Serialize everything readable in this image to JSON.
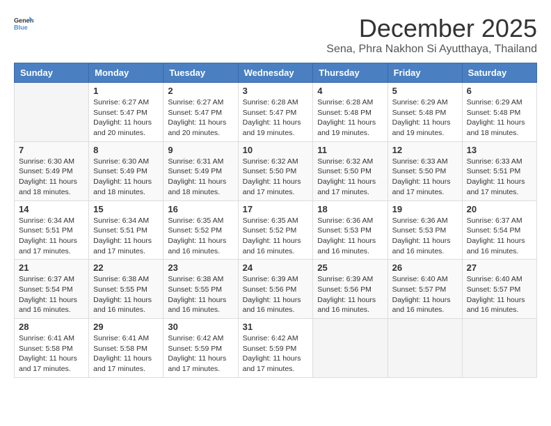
{
  "header": {
    "logo_general": "General",
    "logo_blue": "Blue",
    "month_title": "December 2025",
    "subtitle": "Sena, Phra Nakhon Si Ayutthaya, Thailand"
  },
  "days_of_week": [
    "Sunday",
    "Monday",
    "Tuesday",
    "Wednesday",
    "Thursday",
    "Friday",
    "Saturday"
  ],
  "weeks": [
    [
      {
        "day": "",
        "info": ""
      },
      {
        "day": "1",
        "info": "Sunrise: 6:27 AM\nSunset: 5:47 PM\nDaylight: 11 hours\nand 20 minutes."
      },
      {
        "day": "2",
        "info": "Sunrise: 6:27 AM\nSunset: 5:47 PM\nDaylight: 11 hours\nand 20 minutes."
      },
      {
        "day": "3",
        "info": "Sunrise: 6:28 AM\nSunset: 5:47 PM\nDaylight: 11 hours\nand 19 minutes."
      },
      {
        "day": "4",
        "info": "Sunrise: 6:28 AM\nSunset: 5:48 PM\nDaylight: 11 hours\nand 19 minutes."
      },
      {
        "day": "5",
        "info": "Sunrise: 6:29 AM\nSunset: 5:48 PM\nDaylight: 11 hours\nand 19 minutes."
      },
      {
        "day": "6",
        "info": "Sunrise: 6:29 AM\nSunset: 5:48 PM\nDaylight: 11 hours\nand 18 minutes."
      }
    ],
    [
      {
        "day": "7",
        "info": "Sunrise: 6:30 AM\nSunset: 5:49 PM\nDaylight: 11 hours\nand 18 minutes."
      },
      {
        "day": "8",
        "info": "Sunrise: 6:30 AM\nSunset: 5:49 PM\nDaylight: 11 hours\nand 18 minutes."
      },
      {
        "day": "9",
        "info": "Sunrise: 6:31 AM\nSunset: 5:49 PM\nDaylight: 11 hours\nand 18 minutes."
      },
      {
        "day": "10",
        "info": "Sunrise: 6:32 AM\nSunset: 5:50 PM\nDaylight: 11 hours\nand 17 minutes."
      },
      {
        "day": "11",
        "info": "Sunrise: 6:32 AM\nSunset: 5:50 PM\nDaylight: 11 hours\nand 17 minutes."
      },
      {
        "day": "12",
        "info": "Sunrise: 6:33 AM\nSunset: 5:50 PM\nDaylight: 11 hours\nand 17 minutes."
      },
      {
        "day": "13",
        "info": "Sunrise: 6:33 AM\nSunset: 5:51 PM\nDaylight: 11 hours\nand 17 minutes."
      }
    ],
    [
      {
        "day": "14",
        "info": "Sunrise: 6:34 AM\nSunset: 5:51 PM\nDaylight: 11 hours\nand 17 minutes."
      },
      {
        "day": "15",
        "info": "Sunrise: 6:34 AM\nSunset: 5:51 PM\nDaylight: 11 hours\nand 17 minutes."
      },
      {
        "day": "16",
        "info": "Sunrise: 6:35 AM\nSunset: 5:52 PM\nDaylight: 11 hours\nand 16 minutes."
      },
      {
        "day": "17",
        "info": "Sunrise: 6:35 AM\nSunset: 5:52 PM\nDaylight: 11 hours\nand 16 minutes."
      },
      {
        "day": "18",
        "info": "Sunrise: 6:36 AM\nSunset: 5:53 PM\nDaylight: 11 hours\nand 16 minutes."
      },
      {
        "day": "19",
        "info": "Sunrise: 6:36 AM\nSunset: 5:53 PM\nDaylight: 11 hours\nand 16 minutes."
      },
      {
        "day": "20",
        "info": "Sunrise: 6:37 AM\nSunset: 5:54 PM\nDaylight: 11 hours\nand 16 minutes."
      }
    ],
    [
      {
        "day": "21",
        "info": "Sunrise: 6:37 AM\nSunset: 5:54 PM\nDaylight: 11 hours\nand 16 minutes."
      },
      {
        "day": "22",
        "info": "Sunrise: 6:38 AM\nSunset: 5:55 PM\nDaylight: 11 hours\nand 16 minutes."
      },
      {
        "day": "23",
        "info": "Sunrise: 6:38 AM\nSunset: 5:55 PM\nDaylight: 11 hours\nand 16 minutes."
      },
      {
        "day": "24",
        "info": "Sunrise: 6:39 AM\nSunset: 5:56 PM\nDaylight: 11 hours\nand 16 minutes."
      },
      {
        "day": "25",
        "info": "Sunrise: 6:39 AM\nSunset: 5:56 PM\nDaylight: 11 hours\nand 16 minutes."
      },
      {
        "day": "26",
        "info": "Sunrise: 6:40 AM\nSunset: 5:57 PM\nDaylight: 11 hours\nand 16 minutes."
      },
      {
        "day": "27",
        "info": "Sunrise: 6:40 AM\nSunset: 5:57 PM\nDaylight: 11 hours\nand 16 minutes."
      }
    ],
    [
      {
        "day": "28",
        "info": "Sunrise: 6:41 AM\nSunset: 5:58 PM\nDaylight: 11 hours\nand 17 minutes."
      },
      {
        "day": "29",
        "info": "Sunrise: 6:41 AM\nSunset: 5:58 PM\nDaylight: 11 hours\nand 17 minutes."
      },
      {
        "day": "30",
        "info": "Sunrise: 6:42 AM\nSunset: 5:59 PM\nDaylight: 11 hours\nand 17 minutes."
      },
      {
        "day": "31",
        "info": "Sunrise: 6:42 AM\nSunset: 5:59 PM\nDaylight: 11 hours\nand 17 minutes."
      },
      {
        "day": "",
        "info": ""
      },
      {
        "day": "",
        "info": ""
      },
      {
        "day": "",
        "info": ""
      }
    ]
  ]
}
